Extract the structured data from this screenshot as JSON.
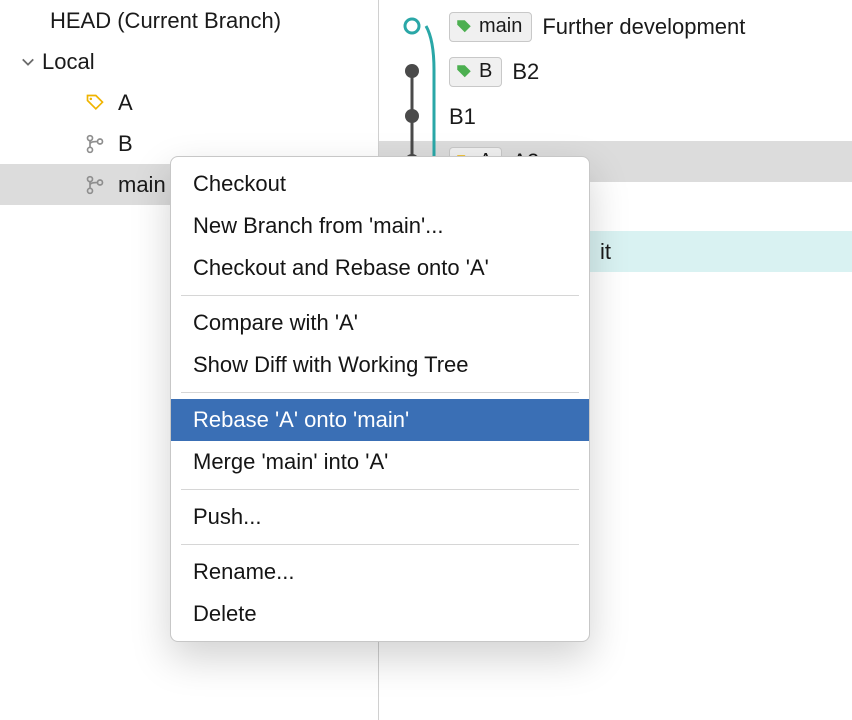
{
  "sidebar": {
    "head_label": "HEAD (Current Branch)",
    "local_label": "Local",
    "branches": {
      "a": "A",
      "b": "B",
      "main": "main"
    }
  },
  "graph": {
    "row0": {
      "pill": "main",
      "msg": "Further development"
    },
    "row1": {
      "pill": "B",
      "msg": "B2"
    },
    "row2": {
      "msg": "B1"
    },
    "row3": {
      "pill": "A",
      "msg": "A2"
    },
    "row5_partial": "it"
  },
  "menu": {
    "checkout": "Checkout",
    "new_branch": "New Branch from 'main'...",
    "checkout_rebase": "Checkout and Rebase onto 'A'",
    "compare": "Compare with 'A'",
    "show_diff": "Show Diff with Working Tree",
    "rebase": "Rebase 'A' onto 'main'",
    "merge": "Merge 'main' into 'A'",
    "push": "Push...",
    "rename": "Rename...",
    "delete": "Delete"
  },
  "colors": {
    "main_tag": "#4caf50",
    "a_tag": "#f0b400",
    "b_tag": "#4caf50",
    "commit_dot": "#4a4a4a",
    "head_dot": "#2aa7a7",
    "branch_gray": "#8e8e8e"
  }
}
